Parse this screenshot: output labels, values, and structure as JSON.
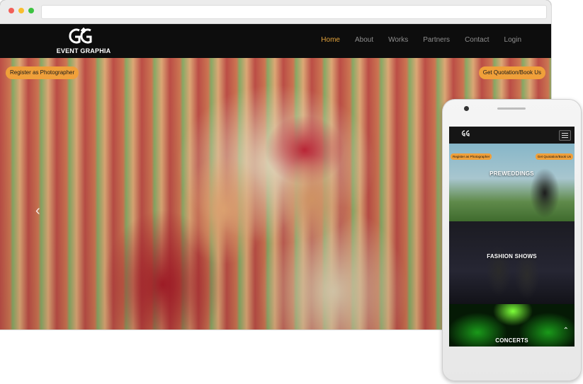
{
  "desktop": {
    "logo_text": "EVENT GRAPHIA",
    "nav": {
      "items": [
        {
          "label": "Home",
          "active": true
        },
        {
          "label": "About",
          "active": false
        },
        {
          "label": "Works",
          "active": false
        },
        {
          "label": "Partners",
          "active": false
        },
        {
          "label": "Contact",
          "active": false
        },
        {
          "label": "Login",
          "active": false
        }
      ]
    },
    "hero": {
      "register_button": "Register as Photographer",
      "quote_button": "Get Quotation/Book Us",
      "prev_icon": "chevron-left-icon"
    }
  },
  "mobile": {
    "menu_icon": "hamburger-icon",
    "panels": [
      {
        "title": "PREWEDDINGS"
      },
      {
        "title": "FASHION SHOWS"
      },
      {
        "title": "CONCERTS"
      }
    ],
    "register_button": "Register as Photographer",
    "quote_button": "Get Quotation/Book Us",
    "scroll_top_icon": "chevron-up-icon"
  },
  "colors": {
    "accent": "#f0a03a",
    "nav_active": "#e2a23b",
    "header_bg": "#0d0d0d"
  }
}
